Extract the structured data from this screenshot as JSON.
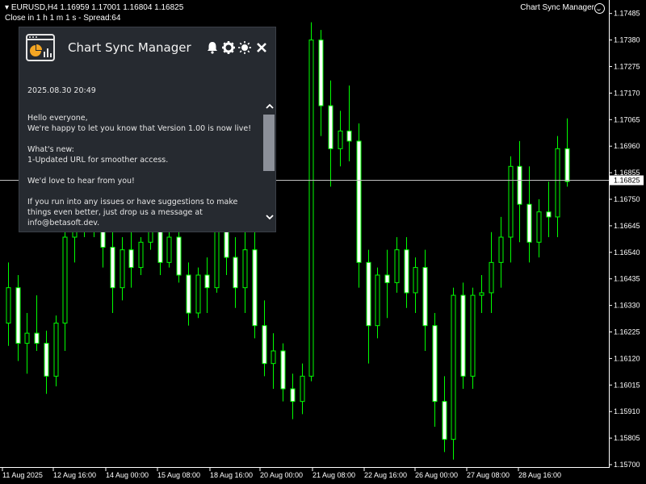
{
  "header": {
    "symbol_line": "EURUSD,H4  1.16959 1.17001 1.16804 1.16825",
    "close_line": "Close in 1 h 1 m 1 s - Spread:64",
    "ea_name": "Chart Sync Manager"
  },
  "colors": {
    "bull": "#00ff00",
    "bear": "#00ff00",
    "bull_fill": "#000000",
    "bear_fill": "#ffffff",
    "grid": "#ffffff",
    "text": "#ffffff",
    "bid_line": "#c0c0c0"
  },
  "chart_data": {
    "type": "candlestick",
    "symbol": "EURUSD",
    "timeframe": "H4",
    "ylim": [
      1.157,
      1.175
    ],
    "y_ticks": [
      "1.17485",
      "1.17380",
      "1.17275",
      "1.17170",
      "1.17065",
      "1.16960",
      "1.16855",
      "1.16750",
      "1.16645",
      "1.16540",
      "1.16435",
      "1.16330",
      "1.16225",
      "1.16120",
      "1.16015",
      "1.15910",
      "1.15805",
      "1.15700"
    ],
    "current_price": "1.16825",
    "x_labels": [
      "11 Aug 2025",
      "12 Aug 16:00",
      "14 Aug 00:00",
      "15 Aug 08:00",
      "18 Aug 16:00",
      "20 Aug 00:00",
      "21 Aug 08:00",
      "22 Aug 16:00",
      "26 Aug 00:00",
      "27 Aug 08:00",
      "28 Aug 16:00"
    ],
    "candles": [
      [
        1.1626,
        1.165,
        1.1617,
        1.164
      ],
      [
        1.164,
        1.1645,
        1.1611,
        1.1618
      ],
      [
        1.1618,
        1.163,
        1.1606,
        1.1622
      ],
      [
        1.1622,
        1.1637,
        1.1615,
        1.1618
      ],
      [
        1.1618,
        1.1623,
        1.1598,
        1.1605
      ],
      [
        1.1605,
        1.1629,
        1.1601,
        1.1626
      ],
      [
        1.1626,
        1.1668,
        1.1615,
        1.166
      ],
      [
        1.166,
        1.168,
        1.165,
        1.167
      ],
      [
        1.167,
        1.169,
        1.166,
        1.1683
      ],
      [
        1.1683,
        1.1692,
        1.166,
        1.1665
      ],
      [
        1.1665,
        1.167,
        1.1648,
        1.1656
      ],
      [
        1.1656,
        1.1665,
        1.163,
        1.164
      ],
      [
        1.164,
        1.166,
        1.1635,
        1.1655
      ],
      [
        1.1655,
        1.1665,
        1.164,
        1.1648
      ],
      [
        1.1648,
        1.166,
        1.1645,
        1.1658
      ],
      [
        1.1658,
        1.167,
        1.1655,
        1.1666
      ],
      [
        1.1666,
        1.1672,
        1.1645,
        1.165
      ],
      [
        1.165,
        1.1665,
        1.1648,
        1.166
      ],
      [
        1.166,
        1.1663,
        1.1642,
        1.1645
      ],
      [
        1.1645,
        1.165,
        1.1625,
        1.163
      ],
      [
        1.163,
        1.1648,
        1.1628,
        1.1645
      ],
      [
        1.1645,
        1.1652,
        1.163,
        1.164
      ],
      [
        1.164,
        1.1668,
        1.1638,
        1.1665
      ],
      [
        1.1665,
        1.169,
        1.1645,
        1.1652
      ],
      [
        1.1652,
        1.166,
        1.1632,
        1.164
      ],
      [
        1.164,
        1.1663,
        1.163,
        1.1655
      ],
      [
        1.1655,
        1.1665,
        1.162,
        1.1625
      ],
      [
        1.1625,
        1.1635,
        1.1605,
        1.161
      ],
      [
        1.161,
        1.1622,
        1.16,
        1.1615
      ],
      [
        1.1615,
        1.1618,
        1.1595,
        1.16
      ],
      [
        1.16,
        1.1606,
        1.1588,
        1.1595
      ],
      [
        1.1595,
        1.161,
        1.159,
        1.1605
      ],
      [
        1.1605,
        1.1745,
        1.1603,
        1.1738
      ],
      [
        1.1738,
        1.1742,
        1.17,
        1.1712
      ],
      [
        1.1712,
        1.1722,
        1.168,
        1.1695
      ],
      [
        1.1695,
        1.171,
        1.1688,
        1.1702
      ],
      [
        1.1702,
        1.172,
        1.169,
        1.1698
      ],
      [
        1.1698,
        1.1705,
        1.164,
        1.165
      ],
      [
        1.165,
        1.1655,
        1.161,
        1.1625
      ],
      [
        1.1625,
        1.1648,
        1.162,
        1.1645
      ],
      [
        1.1645,
        1.1655,
        1.1628,
        1.1642
      ],
      [
        1.1642,
        1.166,
        1.1638,
        1.1655
      ],
      [
        1.1655,
        1.166,
        1.1632,
        1.1638
      ],
      [
        1.1638,
        1.1652,
        1.163,
        1.1648
      ],
      [
        1.1648,
        1.1655,
        1.1615,
        1.1625
      ],
      [
        1.1625,
        1.163,
        1.1585,
        1.1595
      ],
      [
        1.1595,
        1.1605,
        1.1575,
        1.158
      ],
      [
        1.158,
        1.164,
        1.1572,
        1.1637
      ],
      [
        1.1637,
        1.1642,
        1.16,
        1.1605
      ],
      [
        1.1605,
        1.164,
        1.16,
        1.1637
      ],
      [
        1.1637,
        1.1645,
        1.163,
        1.1638
      ],
      [
        1.1638,
        1.1662,
        1.163,
        1.165
      ],
      [
        1.165,
        1.1668,
        1.164,
        1.166
      ],
      [
        1.166,
        1.1692,
        1.165,
        1.1688
      ],
      [
        1.1688,
        1.1698,
        1.1658,
        1.1673
      ],
      [
        1.1673,
        1.1688,
        1.165,
        1.1658
      ],
      [
        1.1658,
        1.1675,
        1.1652,
        1.167
      ],
      [
        1.167,
        1.1682,
        1.166,
        1.1668
      ],
      [
        1.1668,
        1.17,
        1.166,
        1.1695
      ],
      [
        1.1695,
        1.1707,
        1.168,
        1.1682
      ]
    ]
  },
  "panel": {
    "title": "Chart Sync Manager",
    "date": "2025.08.30 20:49",
    "message": "Hello everyone,\nWe're happy to let you know that Version 1.00 is now live!\n\nWhat's new:\n1-Updated URL for smoother access.\n\nWe'd love to hear from you!\n\nIf you run into any issues or have suggestions to make things even better, just drop us a message at info@betasoft.dev.\nYour feedback means a lot and helps us grow together.",
    "icons": [
      "bell-icon",
      "gear-icon",
      "theme-icon",
      "close-icon"
    ]
  }
}
